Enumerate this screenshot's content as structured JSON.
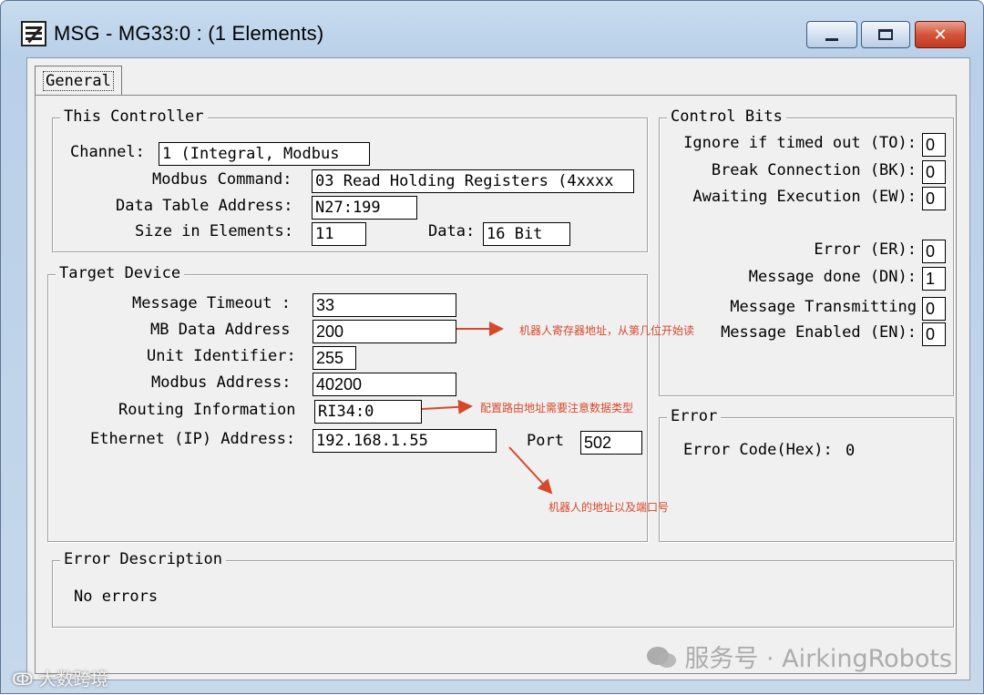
{
  "window": {
    "title": "MSG - MG33:0 : (1 Elements)",
    "minimize_icon": "minimize-icon",
    "maximize_icon": "maximize-icon",
    "close_glyph": "✕"
  },
  "tabs": [
    {
      "label": "General",
      "selected": true
    }
  ],
  "this_controller": {
    "title": "This Controller",
    "channel_label": "Channel:",
    "channel_value": "1 (Integral, Modbus",
    "modbus_command_label": "Modbus Command:",
    "modbus_command_value": "03 Read Holding Registers (4xxxx",
    "data_table_address_label": "Data Table Address:",
    "data_table_address_value": "N27:199",
    "size_in_elements_label": "Size in Elements:",
    "size_in_elements_value": "11",
    "data_label": "Data:",
    "data_value": "16 Bit"
  },
  "target_device": {
    "title": "Target Device",
    "message_timeout_label": "Message Timeout :",
    "message_timeout_value": "33",
    "mb_data_address_label": "MB Data Address",
    "mb_data_address_value": "200",
    "unit_identifier_label": "Unit Identifier:",
    "unit_identifier_value": "255",
    "modbus_address_label": "Modbus Address:",
    "modbus_address_value": "40200",
    "routing_information_label": "Routing Information",
    "routing_information_value": "RI34:0",
    "ethernet_address_label": "Ethernet (IP) Address:",
    "ethernet_address_value": "192.168.1.55",
    "port_label": "Port",
    "port_value": "502"
  },
  "control_bits": {
    "title": "Control Bits",
    "bits": [
      {
        "label": "Ignore if timed out (TO):",
        "value": "0"
      },
      {
        "label": "Break Connection (BK):",
        "value": "0"
      },
      {
        "label": "Awaiting Execution (EW):",
        "value": "0"
      },
      {
        "label": "Error (ER):",
        "value": "0"
      },
      {
        "label": "Message done (DN):",
        "value": "1"
      },
      {
        "label": "Message Transmitting",
        "value": "0"
      },
      {
        "label": "Message Enabled (EN):",
        "value": "0"
      }
    ]
  },
  "error_group": {
    "title": "Error",
    "error_code_label": "Error Code(Hex):",
    "error_code_value": "0"
  },
  "error_description": {
    "title": "Error Description",
    "text": "No errors"
  },
  "annotations": {
    "register_address": "机器人寄存器地址，从第几位开始读",
    "routing_address": "配置路由地址需要注意数据类型",
    "robot_ip_port": "机器人的地址以及端口号",
    "arrow_color": "#d6482b"
  },
  "watermarks": {
    "service_account": "服务号 · AirkingRobots",
    "brand": "大数跨境"
  },
  "colors": {
    "title_bar": "#c9dcef",
    "client_bg": "#f0f0f0",
    "close_button": "#c0391f"
  }
}
